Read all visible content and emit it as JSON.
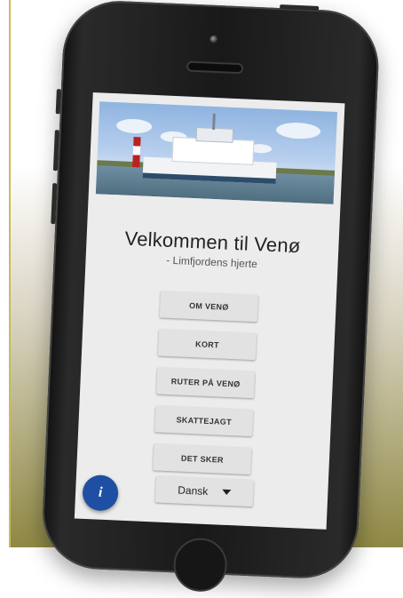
{
  "app": {
    "title": "Velkommen til Venø",
    "subtitle": "- Limfjordens hjerte"
  },
  "menu": {
    "items": [
      {
        "label": "OM VENØ"
      },
      {
        "label": "KORT"
      },
      {
        "label": "RUTER PÅ VENØ"
      },
      {
        "label": "SKATTEJAGT"
      },
      {
        "label": "DET SKER"
      }
    ]
  },
  "language": {
    "selected": "Dansk"
  },
  "info_button": {
    "label": "i"
  },
  "colors": {
    "fab": "#1e4fa3",
    "button_bg": "#e2e2e2",
    "screen_bg": "#ececec"
  },
  "icons": [
    "camera-icon",
    "speaker-icon",
    "info-icon",
    "dropdown-caret-icon"
  ]
}
